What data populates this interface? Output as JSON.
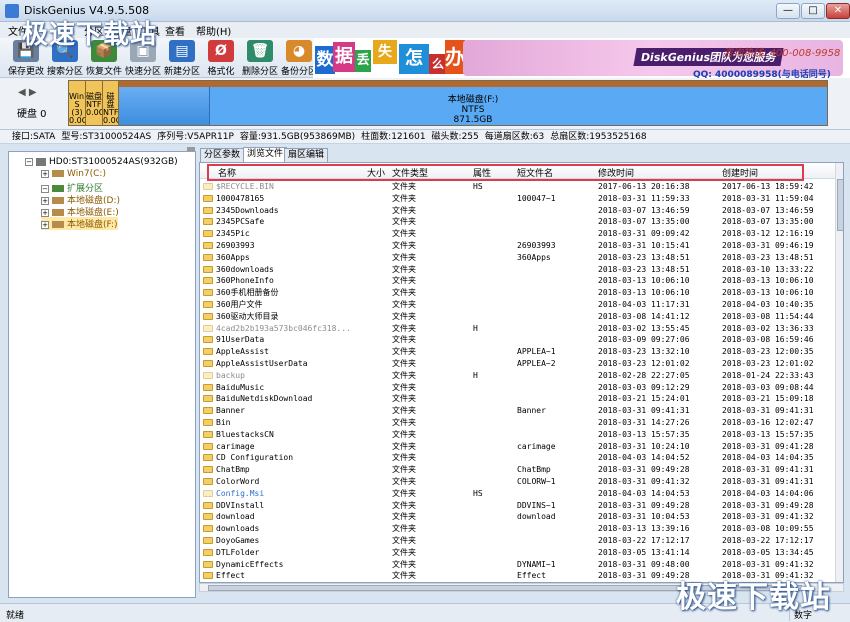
{
  "window": {
    "title": "DiskGenius V4.9.5.508",
    "min": "—",
    "max": "□",
    "close": "✕"
  },
  "menu": [
    "文件",
    "分区",
    "硬盘",
    "工具",
    "查看",
    "帮助(H)"
  ],
  "toolbar": {
    "items": [
      {
        "label": "保存更改",
        "icon": "save-icon",
        "color": "#6a7fa0",
        "glyph": "💾"
      },
      {
        "label": "搜索分区",
        "icon": "search-icon",
        "color": "#2f6fc4",
        "glyph": "🔍"
      },
      {
        "label": "恢复文件",
        "icon": "recover-file-icon",
        "color": "#3d8a3d",
        "glyph": "📦"
      },
      {
        "label": "快速分区",
        "icon": "quick-partition-icon",
        "color": "#9aa7b6",
        "glyph": "▣"
      },
      {
        "label": "新建分区",
        "icon": "new-partition-icon",
        "color": "#2f6fc4",
        "glyph": "▤"
      },
      {
        "label": "格式化",
        "icon": "format-icon",
        "color": "#d23b3b",
        "glyph": "Ø"
      },
      {
        "label": "删除分区",
        "icon": "delete-partition-icon",
        "color": "#2e8c6a",
        "glyph": "🗑"
      },
      {
        "label": "备份分区",
        "icon": "backup-partition-icon",
        "color": "#d88a2a",
        "glyph": "◕"
      }
    ]
  },
  "banner": {
    "chars": [
      "数",
      "据",
      "丢",
      "失",
      "怎",
      "么",
      "办"
    ],
    "phone": "咨询热线: 400-008-9958",
    "team": "DiskGenius团队为您服务",
    "qq": "QQ: 4000089958(与电话同号)"
  },
  "diskstrip": {
    "nav": "◀ ▶",
    "disk_label": "硬盘 0",
    "small_parts": [
      "Win7 S (3) 0.0G",
      "磁盘 NTFS 0.0G",
      "磁盘 NTFS 0.0G"
    ],
    "main_part": {
      "name": "本地磁盘(F:)",
      "fs": "NTFS",
      "size": "871.5GB"
    }
  },
  "info": [
    "接口:SATA",
    "型号:ST31000524AS",
    "序列号:V5APR11P",
    "容量:931.5GB(953869MB)",
    "柱面数:121601",
    "磁头数:255",
    "每道扇区数:63",
    "总扇区数:1953525168"
  ],
  "tree": [
    "HD0:ST31000524AS(932GB)",
    "Win7(C:)",
    "扩展分区",
    "本地磁盘(D:)",
    "本地磁盘(E:)",
    "本地磁盘(F:)"
  ],
  "tabs": [
    "分区参数",
    "浏览文件",
    "扇区编辑"
  ],
  "columns": [
    "名称",
    "大小",
    "文件类型",
    "属性",
    "短文件名",
    "修改时间",
    "创建时间"
  ],
  "files": [
    {
      "name": "$RECYCLE.BIN",
      "type": "文件夹",
      "attr": "HS",
      "short": "",
      "mtime": "2017-06-13 20:16:38",
      "ctime": "2017-06-13 18:59:42",
      "hidden": true
    },
    {
      "name": "1000478165",
      "type": "文件夹",
      "attr": "",
      "short": "100047~1",
      "mtime": "2018-03-31 11:59:33",
      "ctime": "2018-03-31 11:59:04"
    },
    {
      "name": "2345Downloads",
      "type": "文件夹",
      "attr": "",
      "short": "",
      "mtime": "2018-03-07 13:46:59",
      "ctime": "2018-03-07 13:46:59"
    },
    {
      "name": "2345PCSafe",
      "type": "文件夹",
      "attr": "",
      "short": "",
      "mtime": "2018-03-07 13:35:00",
      "ctime": "2018-03-07 13:35:00"
    },
    {
      "name": "2345Pic",
      "type": "文件夹",
      "attr": "",
      "short": "",
      "mtime": "2018-03-31 09:09:42",
      "ctime": "2018-03-12 12:16:19"
    },
    {
      "name": "26903993",
      "type": "文件夹",
      "attr": "",
      "short": "26903993",
      "mtime": "2018-03-31 10:15:41",
      "ctime": "2018-03-31 09:46:19"
    },
    {
      "name": "360Apps",
      "type": "文件夹",
      "attr": "",
      "short": "360Apps",
      "mtime": "2018-03-23 13:48:51",
      "ctime": "2018-03-23 13:48:51"
    },
    {
      "name": "360downloads",
      "type": "文件夹",
      "attr": "",
      "short": "",
      "mtime": "2018-03-23 13:48:51",
      "ctime": "2018-03-10 13:33:22"
    },
    {
      "name": "360PhoneInfo",
      "type": "文件夹",
      "attr": "",
      "short": "",
      "mtime": "2018-03-13 10:06:10",
      "ctime": "2018-03-13 10:06:10"
    },
    {
      "name": "360手机相册备份",
      "type": "文件夹",
      "attr": "",
      "short": "",
      "mtime": "2018-03-13 10:06:10",
      "ctime": "2018-03-13 10:06:10"
    },
    {
      "name": "360用户文件",
      "type": "文件夹",
      "attr": "",
      "short": "",
      "mtime": "2018-04-03 11:17:31",
      "ctime": "2018-04-03 10:40:35"
    },
    {
      "name": "360驱动大师目录",
      "type": "文件夹",
      "attr": "",
      "short": "",
      "mtime": "2018-03-08 14:41:12",
      "ctime": "2018-03-08 11:54:44"
    },
    {
      "name": "4cad2b2b193a573bc046fc318...",
      "type": "文件夹",
      "attr": "H",
      "short": "",
      "mtime": "2018-03-02 13:55:45",
      "ctime": "2018-03-02 13:36:33",
      "hidden": true
    },
    {
      "name": "91UserData",
      "type": "文件夹",
      "attr": "",
      "short": "",
      "mtime": "2018-03-09 09:27:06",
      "ctime": "2018-03-08 16:59:46"
    },
    {
      "name": "AppleAssist",
      "type": "文件夹",
      "attr": "",
      "short": "APPLEA~1",
      "mtime": "2018-03-23 13:32:10",
      "ctime": "2018-03-23 12:00:35"
    },
    {
      "name": "AppleAssistUserData",
      "type": "文件夹",
      "attr": "",
      "short": "APPLEA~2",
      "mtime": "2018-03-23 12:01:02",
      "ctime": "2018-03-23 12:01:02"
    },
    {
      "name": "backup",
      "type": "文件夹",
      "attr": "H",
      "short": "",
      "mtime": "2018-02-28 22:27:05",
      "ctime": "2018-01-24 22:33:43",
      "hidden": true
    },
    {
      "name": "BaiduMusic",
      "type": "文件夹",
      "attr": "",
      "short": "",
      "mtime": "2018-03-03 09:12:29",
      "ctime": "2018-03-03 09:08:44"
    },
    {
      "name": "BaiduNetdiskDownload",
      "type": "文件夹",
      "attr": "",
      "short": "",
      "mtime": "2018-03-21 15:24:01",
      "ctime": "2018-03-21 15:09:18"
    },
    {
      "name": "Banner",
      "type": "文件夹",
      "attr": "",
      "short": "Banner",
      "mtime": "2018-03-31 09:41:31",
      "ctime": "2018-03-31 09:41:31"
    },
    {
      "name": "Bin",
      "type": "文件夹",
      "attr": "",
      "short": "",
      "mtime": "2018-03-31 14:27:26",
      "ctime": "2018-03-16 12:02:47"
    },
    {
      "name": "BluestacksCN",
      "type": "文件夹",
      "attr": "",
      "short": "",
      "mtime": "2018-03-13 15:57:35",
      "ctime": "2018-03-13 15:57:35"
    },
    {
      "name": "carimage",
      "type": "文件夹",
      "attr": "",
      "short": "carimage",
      "mtime": "2018-03-31 10:24:10",
      "ctime": "2018-03-31 09:41:28"
    },
    {
      "name": "CD Configuration",
      "type": "文件夹",
      "attr": "",
      "short": "",
      "mtime": "2018-04-03 14:04:52",
      "ctime": "2018-04-03 14:04:35"
    },
    {
      "name": "ChatBmp",
      "type": "文件夹",
      "attr": "",
      "short": "ChatBmp",
      "mtime": "2018-03-31 09:49:28",
      "ctime": "2018-03-31 09:41:31"
    },
    {
      "name": "ColorWord",
      "type": "文件夹",
      "attr": "",
      "short": "COLORW~1",
      "mtime": "2018-03-31 09:41:32",
      "ctime": "2018-03-31 09:41:31"
    },
    {
      "name": "Config.Msi",
      "type": "文件夹",
      "attr": "HS",
      "short": "",
      "mtime": "2018-04-03 14:04:53",
      "ctime": "2018-04-03 14:04:06",
      "hidden": true,
      "blue": true
    },
    {
      "name": "DDVInstall",
      "type": "文件夹",
      "attr": "",
      "short": "DDVINS~1",
      "mtime": "2018-03-31 09:49:28",
      "ctime": "2018-03-31 09:49:28"
    },
    {
      "name": "download",
      "type": "文件夹",
      "attr": "",
      "short": "download",
      "mtime": "2018-03-31 10:04:53",
      "ctime": "2018-03-31 09:41:32"
    },
    {
      "name": "downloads",
      "type": "文件夹",
      "attr": "",
      "short": "",
      "mtime": "2018-03-13 13:39:16",
      "ctime": "2018-03-08 10:09:55"
    },
    {
      "name": "DoyoGames",
      "type": "文件夹",
      "attr": "",
      "short": "",
      "mtime": "2018-03-22 17:12:17",
      "ctime": "2018-03-22 17:12:17"
    },
    {
      "name": "DTLFolder",
      "type": "文件夹",
      "attr": "",
      "short": "",
      "mtime": "2018-03-05 13:41:14",
      "ctime": "2018-03-05 13:34:45"
    },
    {
      "name": "DynamicEffects",
      "type": "文件夹",
      "attr": "",
      "short": "DYNAMI~1",
      "mtime": "2018-03-31 09:48:00",
      "ctime": "2018-03-31 09:41:32"
    },
    {
      "name": "Effect",
      "type": "文件夹",
      "attr": "",
      "short": "Effect",
      "mtime": "2018-03-31 09:49:28",
      "ctime": "2018-03-31 09:41:32"
    }
  ],
  "status": {
    "left": "就绪",
    "right": "数字"
  },
  "watermark": "极速下载站"
}
